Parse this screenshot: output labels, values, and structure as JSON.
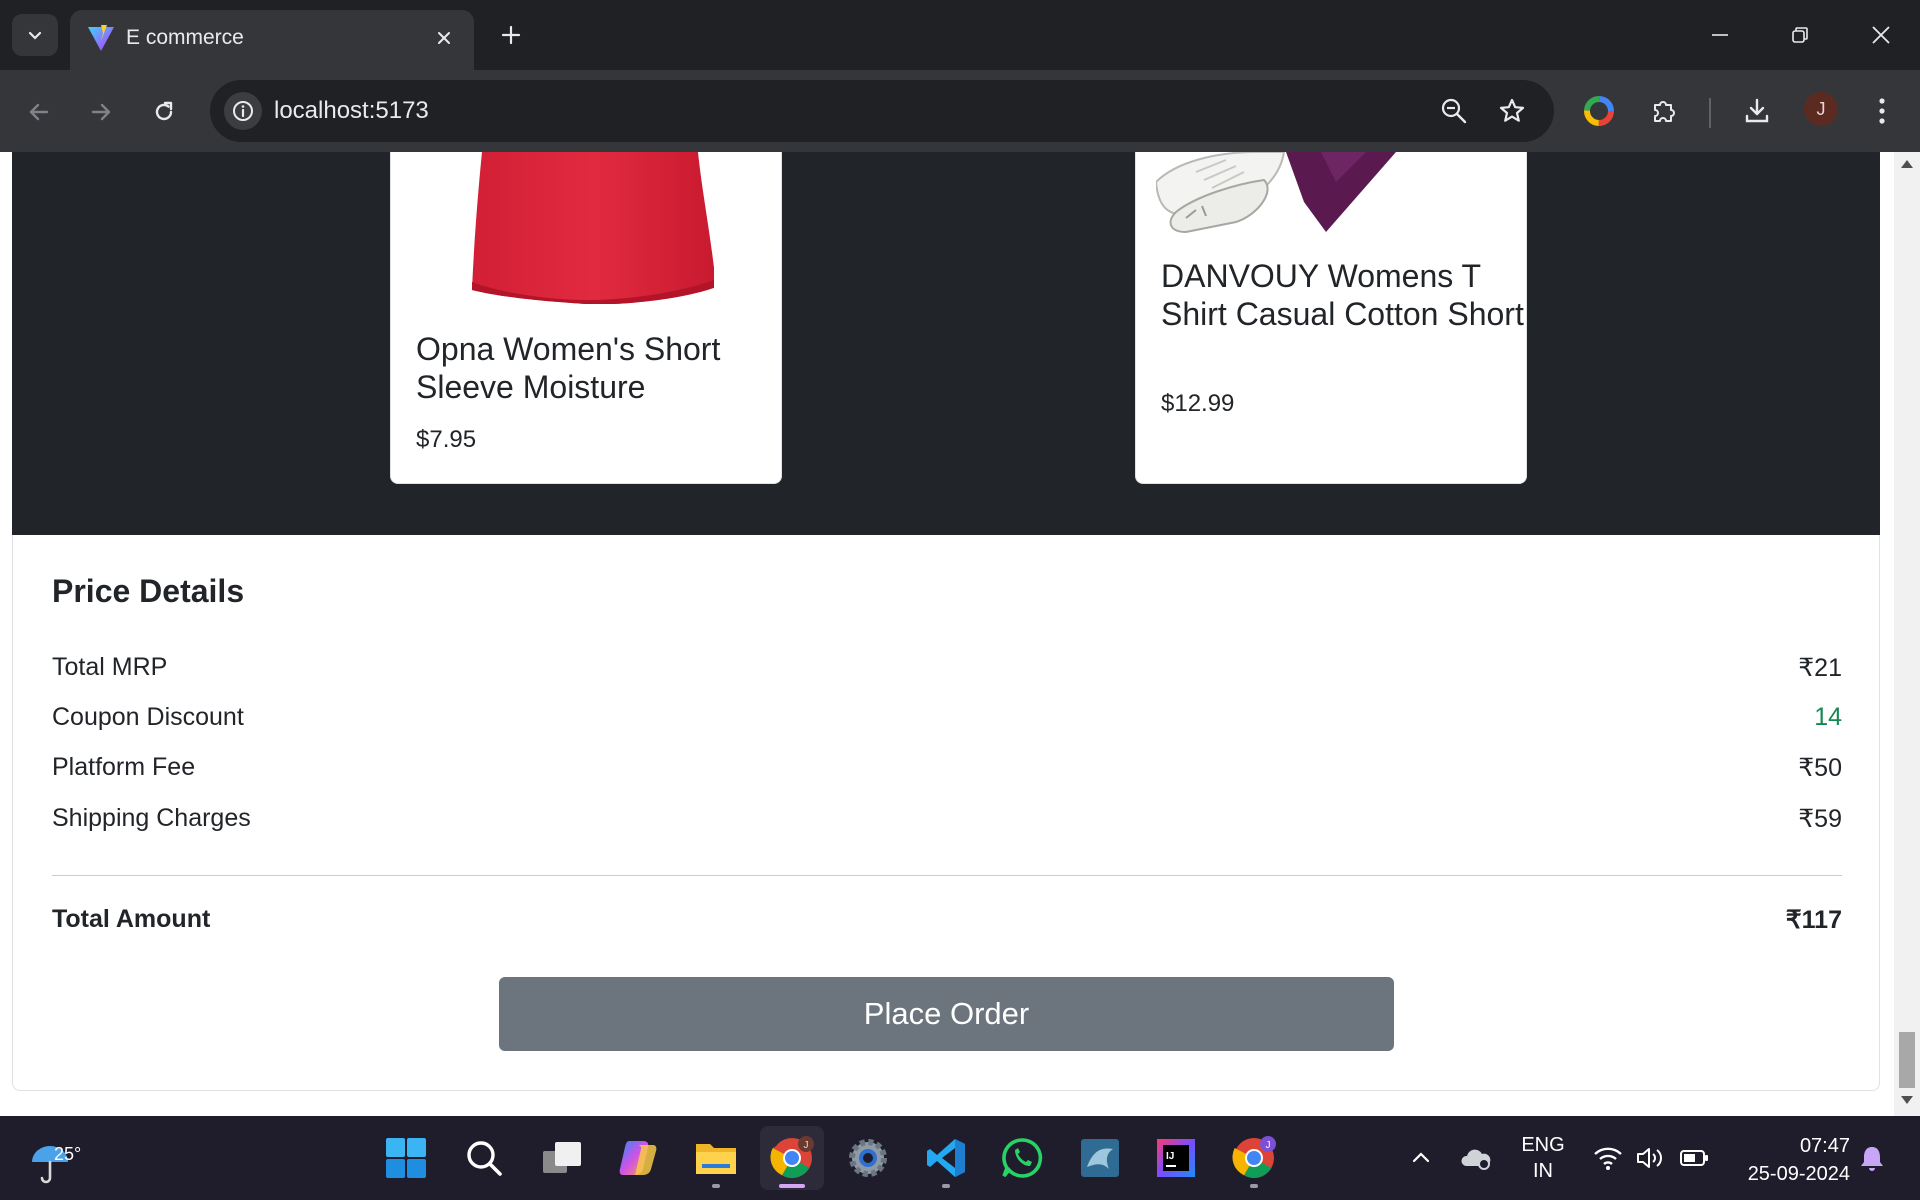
{
  "browser": {
    "tab_title": "E commerce",
    "url": "localhost:5173",
    "profile_initial": "J",
    "icons": {
      "tab_list": "chevron-down-icon",
      "favicon": "vite-logo-icon",
      "close_tab": "close-icon",
      "new_tab": "plus-icon",
      "minimize": "minimize-icon",
      "restore": "restore-icon",
      "close_window": "close-icon",
      "back": "arrow-left-icon",
      "forward": "arrow-right-icon",
      "reload": "reload-icon",
      "site_info": "info-icon",
      "zoom": "zoom-out-icon",
      "bookmark": "star-icon",
      "color_extension": "color-wheel-icon",
      "extensions": "puzzle-icon",
      "downloads": "download-icon",
      "menu": "kebab-menu-icon"
    }
  },
  "products": [
    {
      "title": "Opna Women's Short Sleeve Moisture",
      "price": "$7.95",
      "image_icon": "red-shirt-image"
    },
    {
      "title": "DANVOUY Womens T Shirt Casual Cotton Short",
      "price": "$12.99",
      "image_icon": "sneakers-and-scarf-image"
    }
  ],
  "price_details": {
    "heading": "Price Details",
    "rows": [
      {
        "label": "Total MRP",
        "value": "₹21"
      },
      {
        "label": "Coupon Discount",
        "value": "14",
        "color": "#198754"
      },
      {
        "label": "Platform Fee",
        "value": "₹50"
      },
      {
        "label": "Shipping Charges",
        "value": "₹59"
      }
    ],
    "total_label": "Total Amount",
    "total_value": "₹117",
    "place_order_label": "Place Order"
  },
  "colors": {
    "dark_band": "#212529",
    "button": "#6c757d",
    "discount": "#198754"
  },
  "taskbar": {
    "weather_temp": "25°",
    "language_line1": "ENG",
    "language_line2": "IN",
    "time": "07:47",
    "date": "25-09-2024",
    "apps": [
      "windows-start-icon",
      "search-icon",
      "task-view-icon",
      "copilot-icon",
      "file-explorer-icon",
      "chrome-icon",
      "settings-icon",
      "vscode-icon",
      "whatsapp-icon",
      "mysql-workbench-icon",
      "intellij-icon",
      "chrome-profile-icon"
    ],
    "tray": [
      "chevron-up-icon",
      "onedrive-icon",
      "wifi-icon",
      "volume-icon",
      "battery-icon",
      "notification-bell-icon"
    ]
  }
}
